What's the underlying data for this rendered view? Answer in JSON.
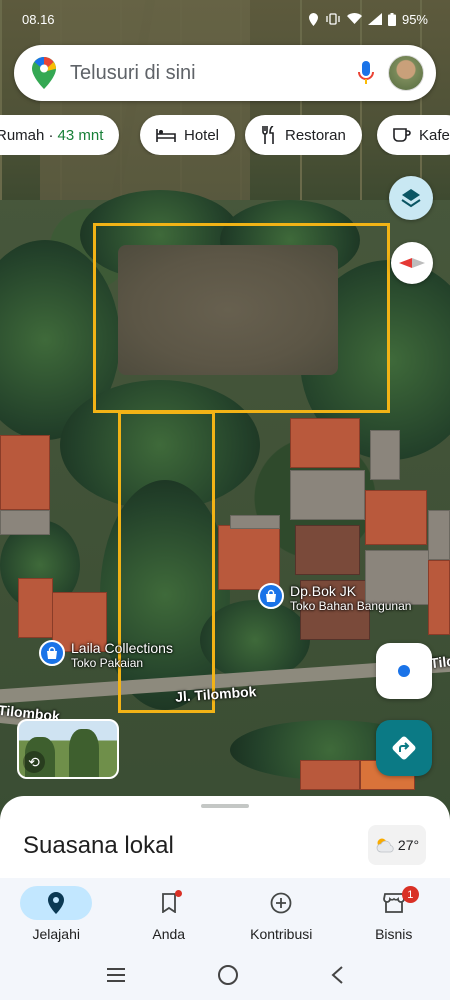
{
  "status_bar": {
    "time": "08.16",
    "battery": "95%"
  },
  "search": {
    "placeholder": "Telusuri di sini"
  },
  "chips": [
    {
      "label": "Rumah · ",
      "extra": "43 mnt"
    },
    {
      "label": "Hotel",
      "icon": "bed-icon"
    },
    {
      "label": "Restoran",
      "icon": "fork-knife-icon"
    },
    {
      "label": "Kafe",
      "icon": "coffee-icon"
    }
  ],
  "map": {
    "streets": [
      "Jl. Tilombok",
      "Tilombok",
      "Tilombok"
    ],
    "pois": [
      {
        "name": "Dp.Bok JK",
        "category": "Toko Bahan Bangunan"
      },
      {
        "name": "Laila Collections",
        "category": "Toko Pakaian"
      }
    ]
  },
  "sheet": {
    "title": "Suasana lokal",
    "weather": "27°"
  },
  "nav": {
    "items": [
      {
        "label": "Jelajahi"
      },
      {
        "label": "Anda"
      },
      {
        "label": "Kontribusi"
      },
      {
        "label": "Bisnis",
        "badge": "1"
      }
    ]
  },
  "colors": {
    "accent": "#1a73e8",
    "boundary": "#f2b316",
    "directions": "#0b7a85",
    "nav_active": "#c2e7ff"
  }
}
